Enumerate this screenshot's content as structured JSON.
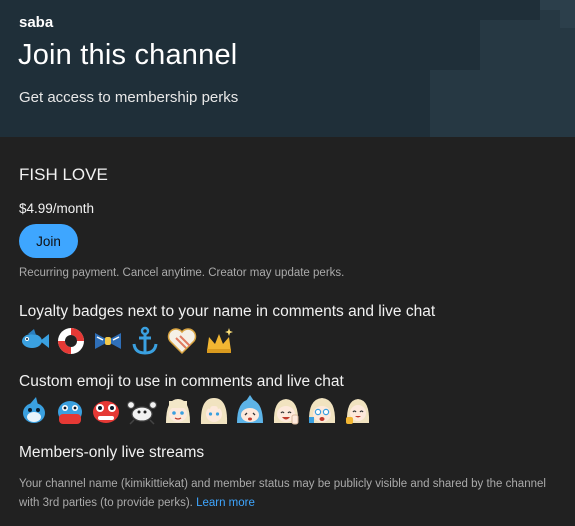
{
  "header": {
    "channel_name": "saba",
    "title": "Join this channel",
    "subtitle": "Get access to membership perks"
  },
  "tier": {
    "name": "FISH LOVE",
    "price": "$4.99/month",
    "join_label": "Join",
    "recurring_note": "Recurring payment. Cancel anytime. Creator may update perks."
  },
  "perks": {
    "badges_heading": "Loyalty badges next to your name in comments and live chat",
    "badges": [
      "fish-badge-icon",
      "lifebuoy-badge-icon",
      "bow-tie-badge-icon",
      "anchor-badge-icon",
      "heart-badge-icon",
      "crown-badge-icon"
    ],
    "emoji_heading": "Custom emoji to use in comments and live chat",
    "emoji": [
      "shark-emoji-icon",
      "shark-hug-emoji-icon",
      "shark-crying-emoji-icon",
      "crab-emoji-icon",
      "girl-smile-emoji-icon",
      "girl-hair-emoji-icon",
      "shark-hood-emoji-icon",
      "girl-peace-emoji-icon",
      "girl-shocked-emoji-icon",
      "girl-thumbsup-emoji-icon"
    ],
    "streams_heading": "Members-only live streams"
  },
  "footer": {
    "notice": "Your channel name (kimikittiekat) and member status may be publicly visible and shared by the channel with 3rd parties (to provide perks).",
    "learn_more": "Learn more"
  },
  "colors": {
    "header_bg": "#1f2f39",
    "page_bg": "#212121",
    "accent": "#3ea6ff"
  }
}
